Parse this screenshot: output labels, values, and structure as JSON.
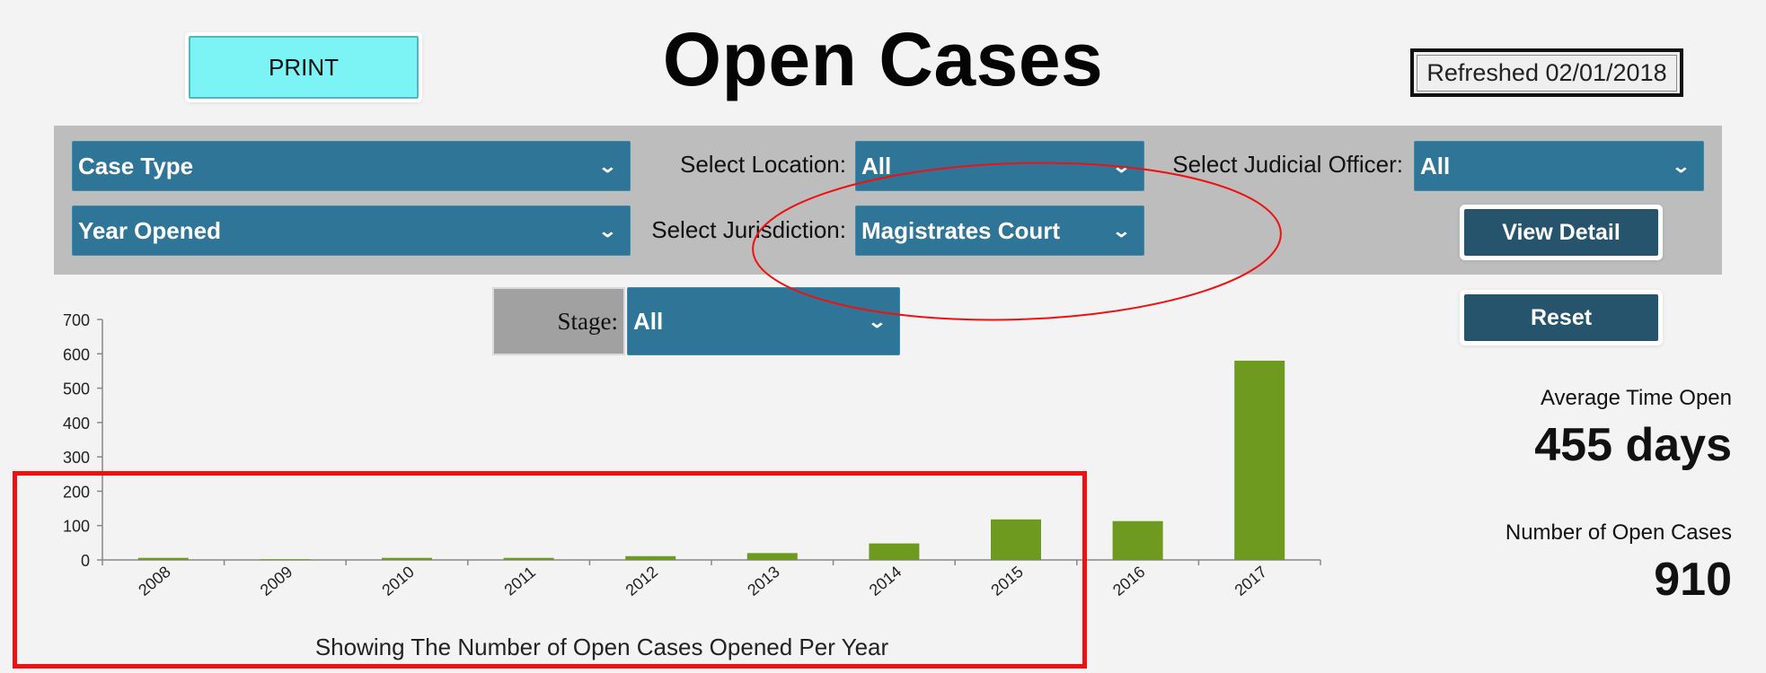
{
  "header": {
    "print_label": "PRINT",
    "title": "Open Cases",
    "refreshed": "Refreshed 02/01/2018"
  },
  "filters": {
    "case_type": "Case Type",
    "year_opened": "Year Opened",
    "location_label": "Select Location:",
    "location_value": "All",
    "jurisdiction_label": "Select Jurisdiction:",
    "jurisdiction_value": "Magistrates Court",
    "officer_label": "Select Judicial Officer:",
    "officer_value": "All",
    "stage_label": "Stage:",
    "stage_value": "All",
    "view_detail_label": "View Detail",
    "reset_label": "Reset"
  },
  "kpis": {
    "avg_time_label": "Average Time Open",
    "avg_time_value": "455 days",
    "open_cases_label": "Number of Open Cases",
    "open_cases_value": "910"
  },
  "colors": {
    "bar": "#6e9a1f",
    "dropdown": "#2f7598",
    "button_dark": "#27546d",
    "print_button": "#7cf3f4",
    "annotation": "#ee1111"
  },
  "chart_data": {
    "type": "bar",
    "title": "",
    "xlabel": "Showing The Number of Open Cases Opened Per Year",
    "ylabel": "",
    "categories": [
      "2008",
      "2009",
      "2010",
      "2011",
      "2012",
      "2013",
      "2014",
      "2015",
      "2016",
      "2017"
    ],
    "values": [
      6,
      2,
      6,
      6,
      11,
      20,
      48,
      118,
      113,
      580
    ],
    "ylim": [
      0,
      700
    ],
    "yticks": [
      0,
      100,
      200,
      300,
      400,
      500,
      600,
      700
    ],
    "grid": false,
    "legend": "none"
  }
}
